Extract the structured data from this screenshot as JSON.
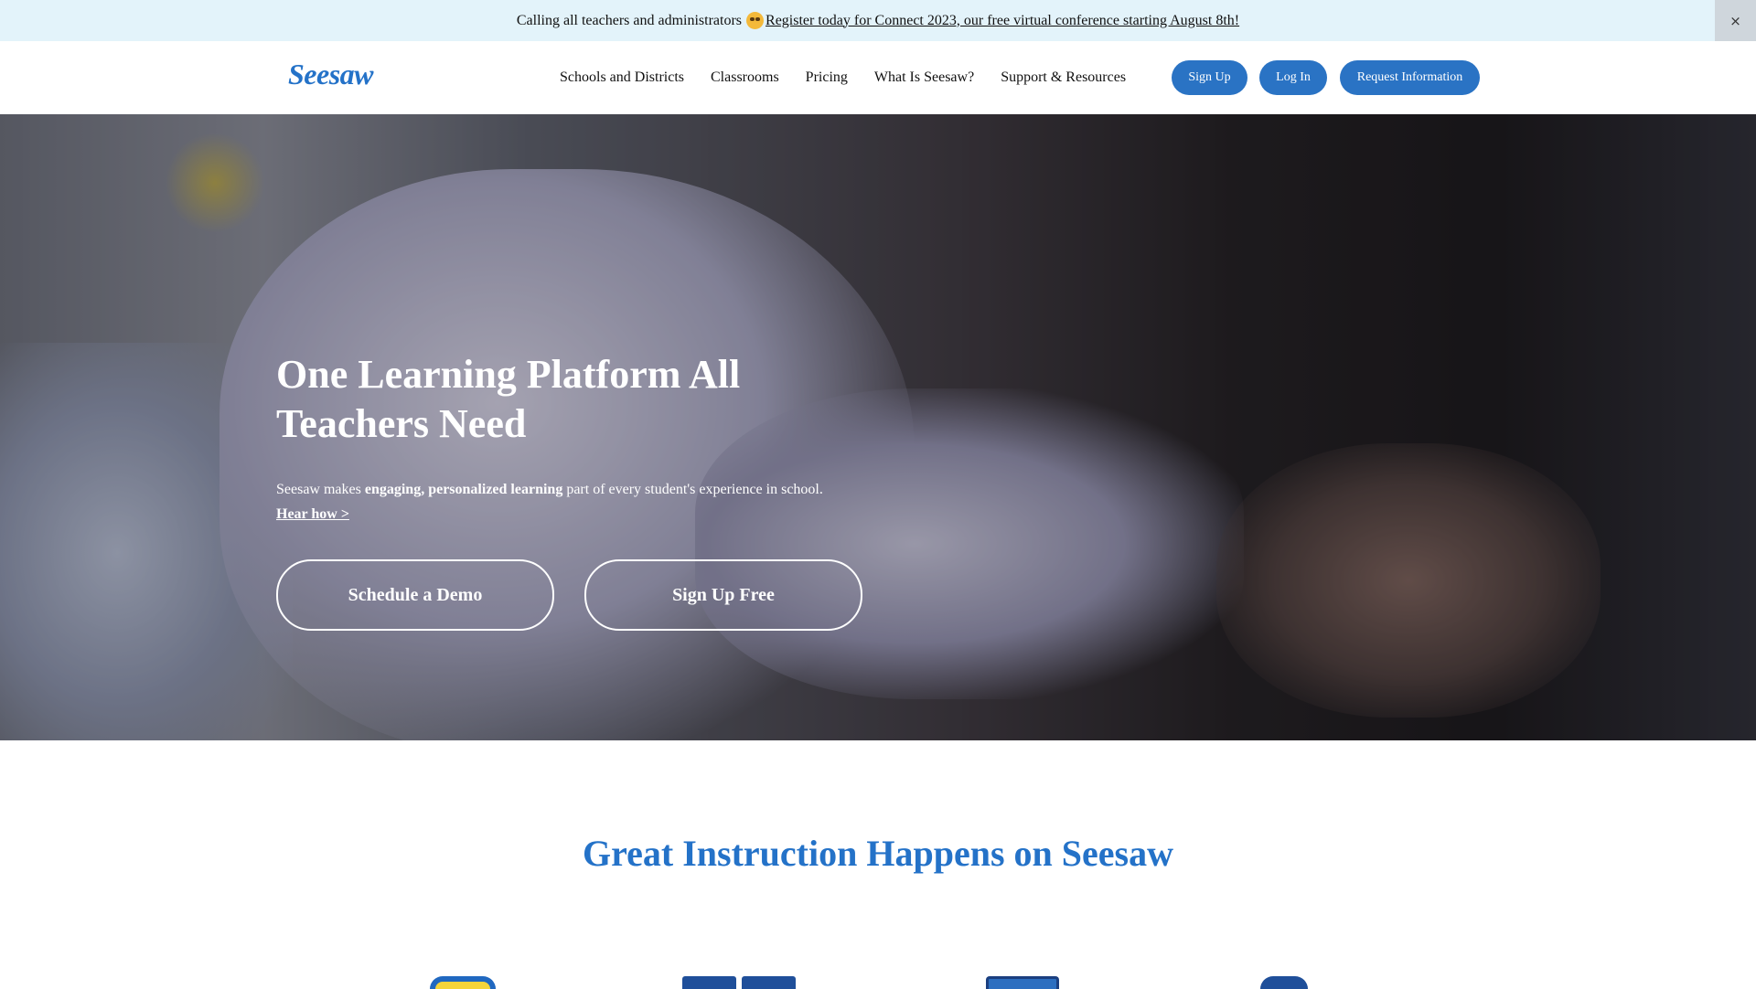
{
  "announcement": {
    "prefix": "Calling all teachers and administrators",
    "emoji_icon": "star-struck-emoji-icon",
    "link_text": "Register today for Connect 2023, our free virtual conference starting August 8th!",
    "close_label": "×"
  },
  "header": {
    "logo": "Seesaw",
    "nav": [
      "Schools and Districts",
      "Classrooms",
      "Pricing",
      "What Is Seesaw?",
      "Support & Resources"
    ],
    "signup": "Sign Up",
    "login": "Log In",
    "request": "Request Information"
  },
  "hero": {
    "title": "One Learning Platform All Teachers Need",
    "sub_pre": "Seesaw makes ",
    "sub_bold": "engaging, personalized learning",
    "sub_post": " part of every student's experience in school.",
    "link": "Hear how >",
    "btn_demo": "Schedule a Demo",
    "btn_free": "Sign Up Free"
  },
  "section": {
    "title": "Great Instruction Happens on Seesaw"
  },
  "colors": {
    "brand_blue": "#2472c8",
    "button_blue": "#2a73c4",
    "announce_bg": "#e3f3fa"
  }
}
